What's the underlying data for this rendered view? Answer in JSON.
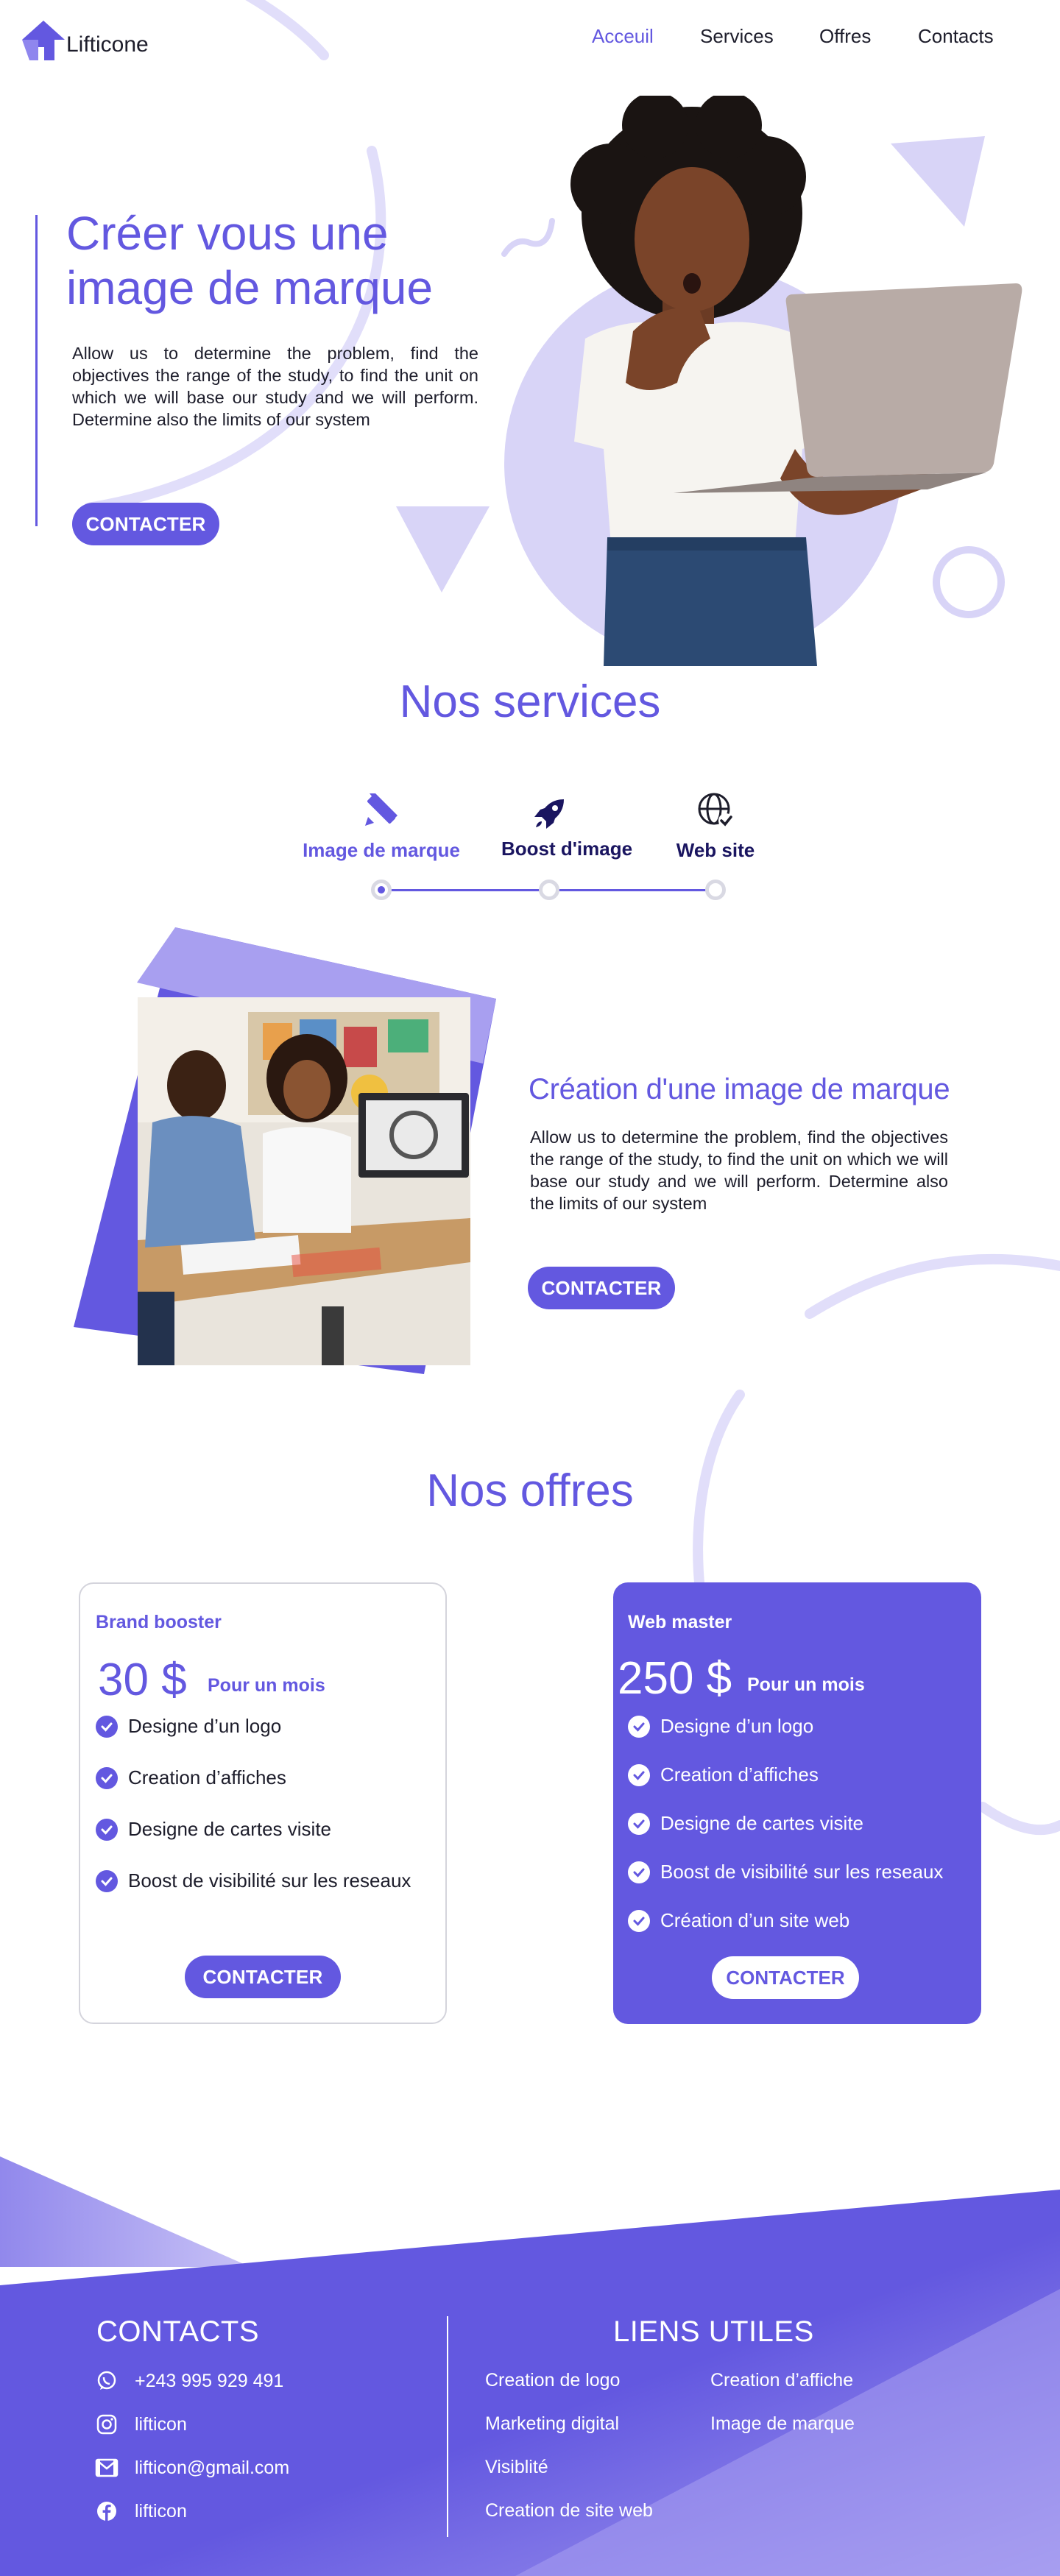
{
  "brand": {
    "name": "Lifticone"
  },
  "nav": {
    "items": [
      "Acceuil",
      "Services",
      "Offres",
      "Contacts"
    ],
    "active_index": 0
  },
  "hero": {
    "title": "Créer vous une image de marque",
    "text": "Allow us to determine the problem, find the objectives the range of the study, to find the unit on which we will base our study and we will perform. Determine also the limits of our system",
    "cta": "CONTACTER"
  },
  "services": {
    "title": "Nos services",
    "tabs": [
      {
        "label": "Image de marque",
        "icon": "pen-ruler-icon"
      },
      {
        "label": "Boost d'image",
        "icon": "rocket-icon"
      },
      {
        "label": "Web site",
        "icon": "globe-check-icon"
      }
    ],
    "active_index": 0,
    "detail": {
      "title": "Création d'une image de marque",
      "text": "Allow us to determine the problem, find the objectives the range of the study, to find the unit on which we will base our study and we will perform. Determine also the limits of our system",
      "cta": "CONTACTER"
    }
  },
  "offers": {
    "title": "Nos offres",
    "plans": [
      {
        "name": "Brand booster",
        "price": "30 $",
        "period": "Pour un mois",
        "features": [
          "Designe d’un logo",
          "Creation d’affiches",
          "Designe de cartes visite",
          "Boost de visibilité sur les reseaux"
        ],
        "cta": "CONTACTER"
      },
      {
        "name": "Web master",
        "price": "250 $",
        "period": "Pour un mois",
        "features": [
          "Designe d’un logo",
          "Creation d’affiches",
          "Designe de cartes visite",
          "Boost de visibilité sur les reseaux",
          "Création d’un site web"
        ],
        "cta": "CONTACTER"
      }
    ]
  },
  "footer": {
    "contacts_title": "CONTACTS",
    "contacts": [
      {
        "icon": "whatsapp-icon",
        "text": "+243 995 929 491"
      },
      {
        "icon": "instagram-icon",
        "text": "lifticon"
      },
      {
        "icon": "gmail-icon",
        "text": "lifticon@gmail.com"
      },
      {
        "icon": "facebook-icon",
        "text": "lifticon"
      }
    ],
    "links_title": "LIENS UTILES",
    "links": [
      "Creation de logo",
      "Creation d’affiche",
      "Marketing digital",
      "Image de marque",
      "Visiblité",
      "Creation de site web"
    ]
  },
  "colors": {
    "accent": "#6358e0",
    "accent_light": "#d8d4f7",
    "text": "#1d1d2b"
  }
}
